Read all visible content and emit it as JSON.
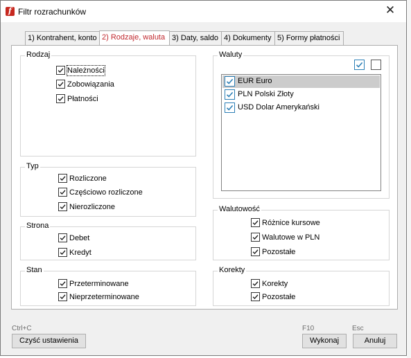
{
  "window": {
    "title": "Filtr rozrachunków",
    "close_glyph": "✕"
  },
  "tabs": [
    {
      "label": "1) Kontrahent, konto"
    },
    {
      "label": "2) Rodzaje, waluta"
    },
    {
      "label": "3) Daty, saldo"
    },
    {
      "label": "4) Dokumenty"
    },
    {
      "label": "5) Formy płatności"
    }
  ],
  "rodzaj": {
    "label": "Rodzaj",
    "items": [
      {
        "label": "Należności",
        "checked": true
      },
      {
        "label": "Zobowiązania",
        "checked": true
      },
      {
        "label": "Płatności",
        "checked": true
      }
    ]
  },
  "typ": {
    "label": "Typ",
    "items": [
      {
        "label": "Rozliczone",
        "checked": true
      },
      {
        "label": "Częściowo rozliczone",
        "checked": true
      },
      {
        "label": "Nierozliczone",
        "checked": true
      }
    ]
  },
  "strona": {
    "label": "Strona",
    "items": [
      {
        "label": "Debet",
        "checked": true
      },
      {
        "label": "Kredyt",
        "checked": true
      }
    ]
  },
  "stan": {
    "label": "Stan",
    "items": [
      {
        "label": "Przeterminowane",
        "checked": true
      },
      {
        "label": "Nieprzeterminowane",
        "checked": true
      }
    ]
  },
  "waluty": {
    "label": "Waluty",
    "select_all_checked": true,
    "clear_all_checked": false,
    "items": [
      {
        "label": "EUR Euro",
        "checked": true,
        "selected": true
      },
      {
        "label": "PLN Polski Złoty",
        "checked": true,
        "selected": false
      },
      {
        "label": "USD Dolar Amerykański",
        "checked": true,
        "selected": false
      }
    ]
  },
  "walutowosc": {
    "label": "Walutowość",
    "items": [
      {
        "label": "Różnice kursowe",
        "checked": true
      },
      {
        "label": "Walutowe w PLN",
        "checked": true
      },
      {
        "label": "Pozostałe",
        "checked": true
      }
    ]
  },
  "korekty": {
    "label": "Korekty",
    "items": [
      {
        "label": "Korekty",
        "checked": true
      },
      {
        "label": "Pozostałe",
        "checked": true
      }
    ]
  },
  "footer": {
    "clear_shortcut": "Ctrl+C",
    "clear_label": "Czyść ustawienia",
    "execute_shortcut": "F10",
    "execute_label": "Wykonaj",
    "cancel_shortcut": "Esc",
    "cancel_label": "Anuluj"
  },
  "colors": {
    "accent": "#c0272d",
    "check_blue": "#2c7fb6",
    "selected_row": "#cccccc"
  }
}
